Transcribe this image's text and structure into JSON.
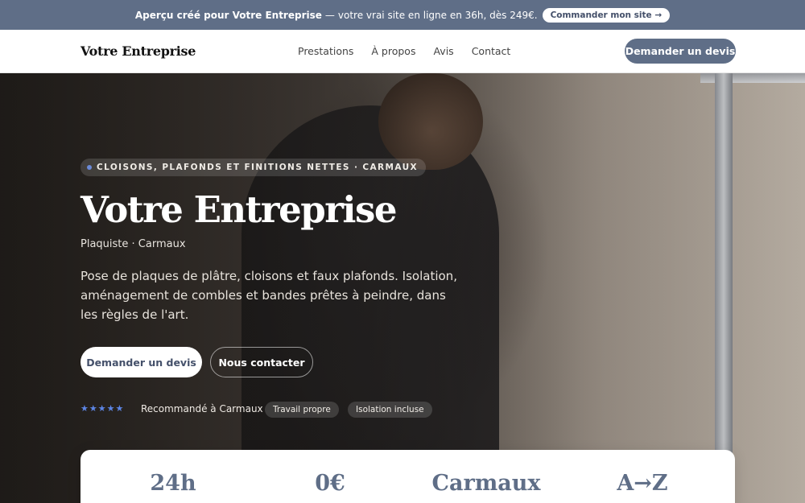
{
  "promo": {
    "lead": "Aperçu créé pour Votre Entreprise",
    "separator": "—",
    "text": "votre vrai site en ligne en 36h, dès 249€.",
    "cta": "Commander mon site →"
  },
  "nav": {
    "brand": "Votre Entreprise",
    "links": [
      "Prestations",
      "À propos",
      "Avis",
      "Contact"
    ],
    "cta": "Demander un devis"
  },
  "hero": {
    "tag": "CLOISONS, PLAFONDS ET FINITIONS NETTES · CARMAUX",
    "title": "Votre Entreprise",
    "subtitle": "Plaquiste · Carmaux",
    "description": "Pose de plaques de plâtre, cloisons et faux plafonds. Isolation, aménagement de combles et bandes prêtes à peindre, dans les règles de l'art.",
    "primary_cta": "Demander un devis",
    "secondary_cta": "Nous contacter",
    "stars": "★★★★★",
    "recommendation": "Recommandé à Carmaux",
    "chips": [
      "Travail propre",
      "Isolation incluse"
    ]
  },
  "stats": [
    "24h",
    "0€",
    "Carmaux",
    "A→Z"
  ],
  "colors": {
    "accent": "#5f6e87",
    "star": "#5d86e6"
  }
}
